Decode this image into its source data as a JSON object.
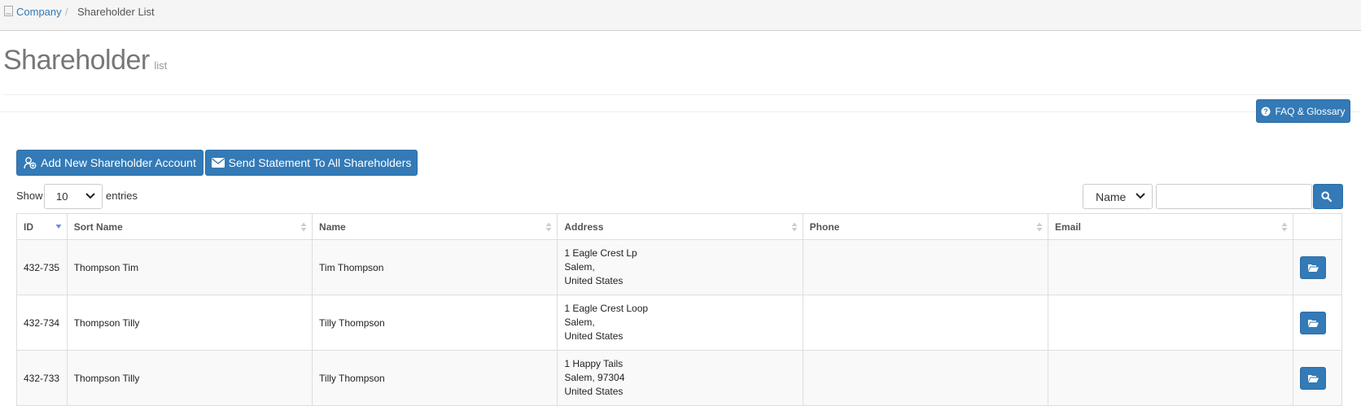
{
  "breadcrumb": {
    "home_icon": "document-icon",
    "link": "Company",
    "separator": "/",
    "current": "Shareholder List"
  },
  "title": {
    "main": "Shareholder",
    "sub": "list"
  },
  "faq_button": {
    "label": "FAQ & Glossary",
    "icon": "question-circle-icon"
  },
  "actions": {
    "add_label": "Add New Shareholder Account",
    "add_icon": "user-add-icon",
    "send_label": "Send Statement To All Shareholders",
    "send_icon": "envelope-icon"
  },
  "length_control": {
    "show": "Show",
    "value": "10",
    "entries": "entries"
  },
  "filter": {
    "field": "Name",
    "search_value": "",
    "search_icon": "search-icon"
  },
  "table": {
    "columns": [
      "ID",
      "Sort Name",
      "Name",
      "Address",
      "Phone",
      "Email"
    ],
    "rows": [
      {
        "id": "432-735",
        "sort_name": "Thompson Tim",
        "name": "Tim Thompson",
        "address": [
          "1 Eagle Crest Lp",
          "Salem,",
          "United States"
        ],
        "phone": "",
        "email": ""
      },
      {
        "id": "432-734",
        "sort_name": "Thompson Tilly",
        "name": "Tilly Thompson",
        "address": [
          "1 Eagle Crest Loop",
          "Salem,",
          "United States"
        ],
        "phone": "",
        "email": ""
      },
      {
        "id": "432-733",
        "sort_name": "Thompson Tilly",
        "name": "Tilly Thompson",
        "address": [
          "1 Happy Tails",
          "Salem, 97304",
          "United States"
        ],
        "phone": "",
        "email": ""
      }
    ],
    "row_action_icon": "folder-open-icon"
  },
  "colors": {
    "primary": "#337ab7",
    "link": "#337ab7",
    "stripe": "#f9f9f9"
  }
}
